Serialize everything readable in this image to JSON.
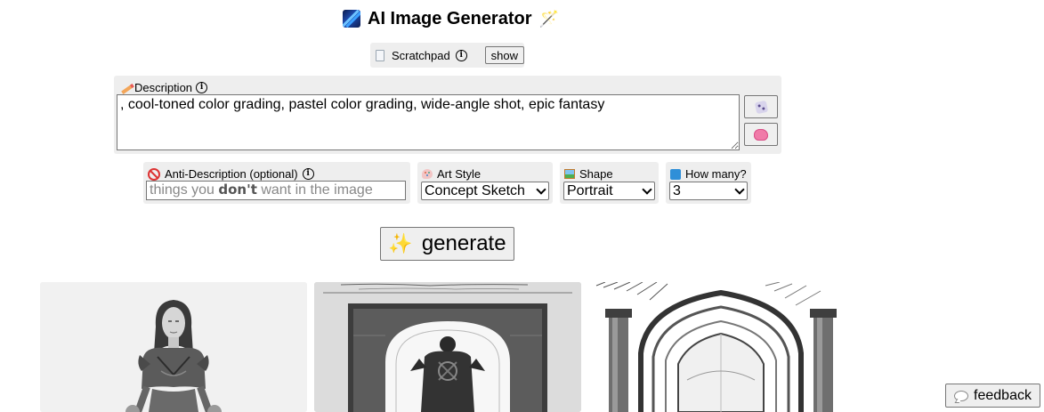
{
  "header": {
    "title": "AI Image Generator",
    "logo_icon": "image-logo-icon",
    "wand_icon": "magic-wand-icon"
  },
  "scratchpad": {
    "label": "Scratchpad",
    "show_button": "show"
  },
  "description": {
    "label": "Description",
    "value": ", cool-toned color grading, pastel color grading, wide-angle shot, epic fantasy",
    "random_button_icon": "dice-icon",
    "ai_button_icon": "brain-icon"
  },
  "anti_description": {
    "label": "Anti-Description (optional)",
    "placeholder_pre": "things you ",
    "placeholder_bold": "don't",
    "placeholder_post": " want in the image"
  },
  "art_style": {
    "label": "Art Style",
    "selected": "Concept Sketch"
  },
  "shape": {
    "label": "Shape",
    "selected": "Portrait"
  },
  "how_many": {
    "label": "How many?",
    "selected": "3"
  },
  "generate_button": "generate",
  "results": [
    {
      "subject": "woman in armor sketch"
    },
    {
      "subject": "knight under archway sketch"
    },
    {
      "subject": "gothic arch architecture sketch"
    }
  ],
  "feedback_button": "feedback"
}
